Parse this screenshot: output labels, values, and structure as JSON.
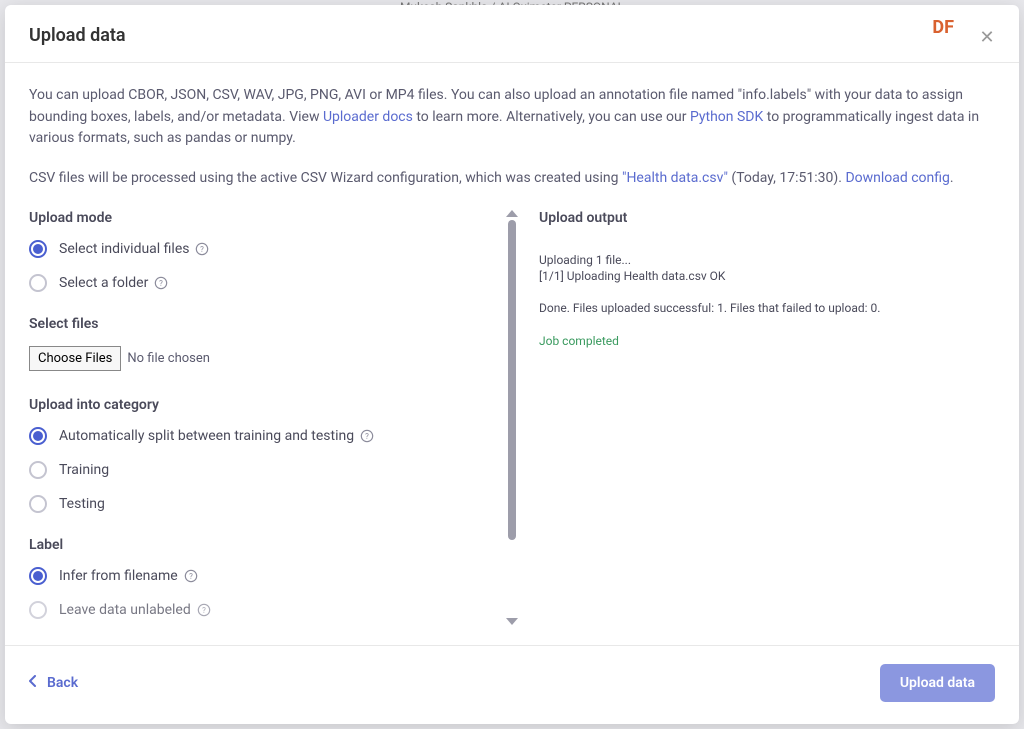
{
  "bg": {
    "user": "Mukesh Sankhla",
    "project": "AI Oximeter",
    "tag": "PERSONAL"
  },
  "header": {
    "title": "Upload data",
    "badge": "DF"
  },
  "intro": {
    "part1": "You can upload CBOR, JSON, CSV, WAV, JPG, PNG, AVI or MP4 files. You can also upload an annotation file named \"info.labels\" with your data to assign bounding boxes, labels, and/or metadata. View ",
    "link1": "Uploader docs",
    "part2": " to learn more. Alternatively, you can use our ",
    "link2": "Python SDK",
    "part3": " to programmatically ingest data in various formats, such as pandas or numpy."
  },
  "csv": {
    "part1": "CSV files will be processed using the active CSV Wizard configuration, which was created using ",
    "filename": "\"Health data.csv\"",
    "timestamp": " (Today, 17:51:30). ",
    "download_link": "Download config",
    "period": "."
  },
  "left": {
    "upload_mode_heading": "Upload mode",
    "mode_individual": "Select individual files",
    "mode_folder": "Select a folder",
    "select_files_heading": "Select files",
    "choose_files_btn": "Choose Files",
    "no_file": "No file chosen",
    "category_heading": "Upload into category",
    "cat_auto": "Automatically split between training and testing",
    "cat_training": "Training",
    "cat_testing": "Testing",
    "label_heading": "Label",
    "label_infer": "Infer from filename",
    "label_unlabeled": "Leave data unlabeled"
  },
  "output": {
    "heading": "Upload output",
    "line1": "Uploading 1 file...",
    "line2": "[1/1] Uploading Health data.csv OK",
    "line3": "Done. Files uploaded successful: 1. Files that failed to upload: 0.",
    "line4": "Job completed"
  },
  "footer": {
    "back": "Back",
    "upload": "Upload data"
  }
}
